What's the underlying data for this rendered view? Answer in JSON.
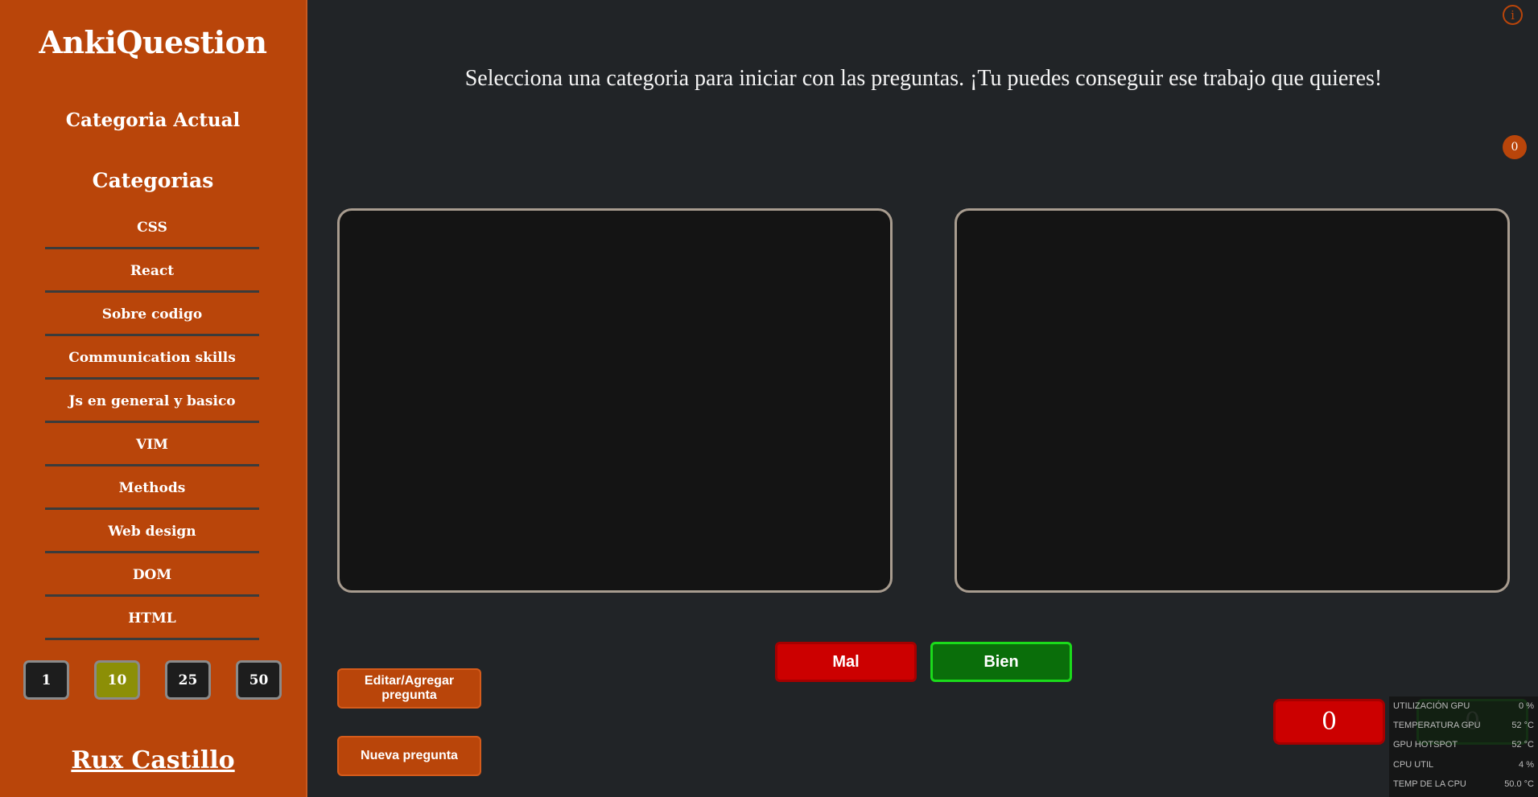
{
  "app": {
    "title": "AnkiQuestion"
  },
  "sidebar": {
    "current_category_label": "Categoria Actual",
    "categories_title": "Categorias",
    "categories": [
      "CSS",
      "React",
      "Sobre codigo",
      "Communication skills",
      "Js en general y basico",
      "VIM",
      "Methods",
      "Web design",
      "DOM",
      "HTML"
    ],
    "counts": [
      "1",
      "10",
      "25",
      "50"
    ],
    "selected_count": "10",
    "author": "Rux Castillo"
  },
  "main": {
    "prompt": "Selecciona una categoria para iniciar con las preguntas. ¡Tu puedes conseguir ese trabajo que quieres!",
    "info_icon": "info-icon",
    "badge_count": "0",
    "edit_button": "Editar/Agregar pregunta",
    "new_button": "Nueva pregunta",
    "mal_button": "Mal",
    "bien_button": "Bien",
    "score_wrong": "0",
    "score_right": "0"
  },
  "overlay": {
    "rows": [
      {
        "label": "UTILIZACIÓN GPU",
        "value": "0 %"
      },
      {
        "label": "TEMPERATURA GPU",
        "value": "52 °C"
      },
      {
        "label": "GPU HOTSPOT",
        "value": "52 °C"
      },
      {
        "label": "CPU UTIL",
        "value": "4 %"
      },
      {
        "label": "TEMP DE LA CPU",
        "value": "50.0 °C"
      }
    ]
  },
  "colors": {
    "accent": "#b9450a",
    "background": "#212427",
    "wrong": "#cc0000",
    "right": "#0a6e0a",
    "count_active": "#8c8f06"
  }
}
